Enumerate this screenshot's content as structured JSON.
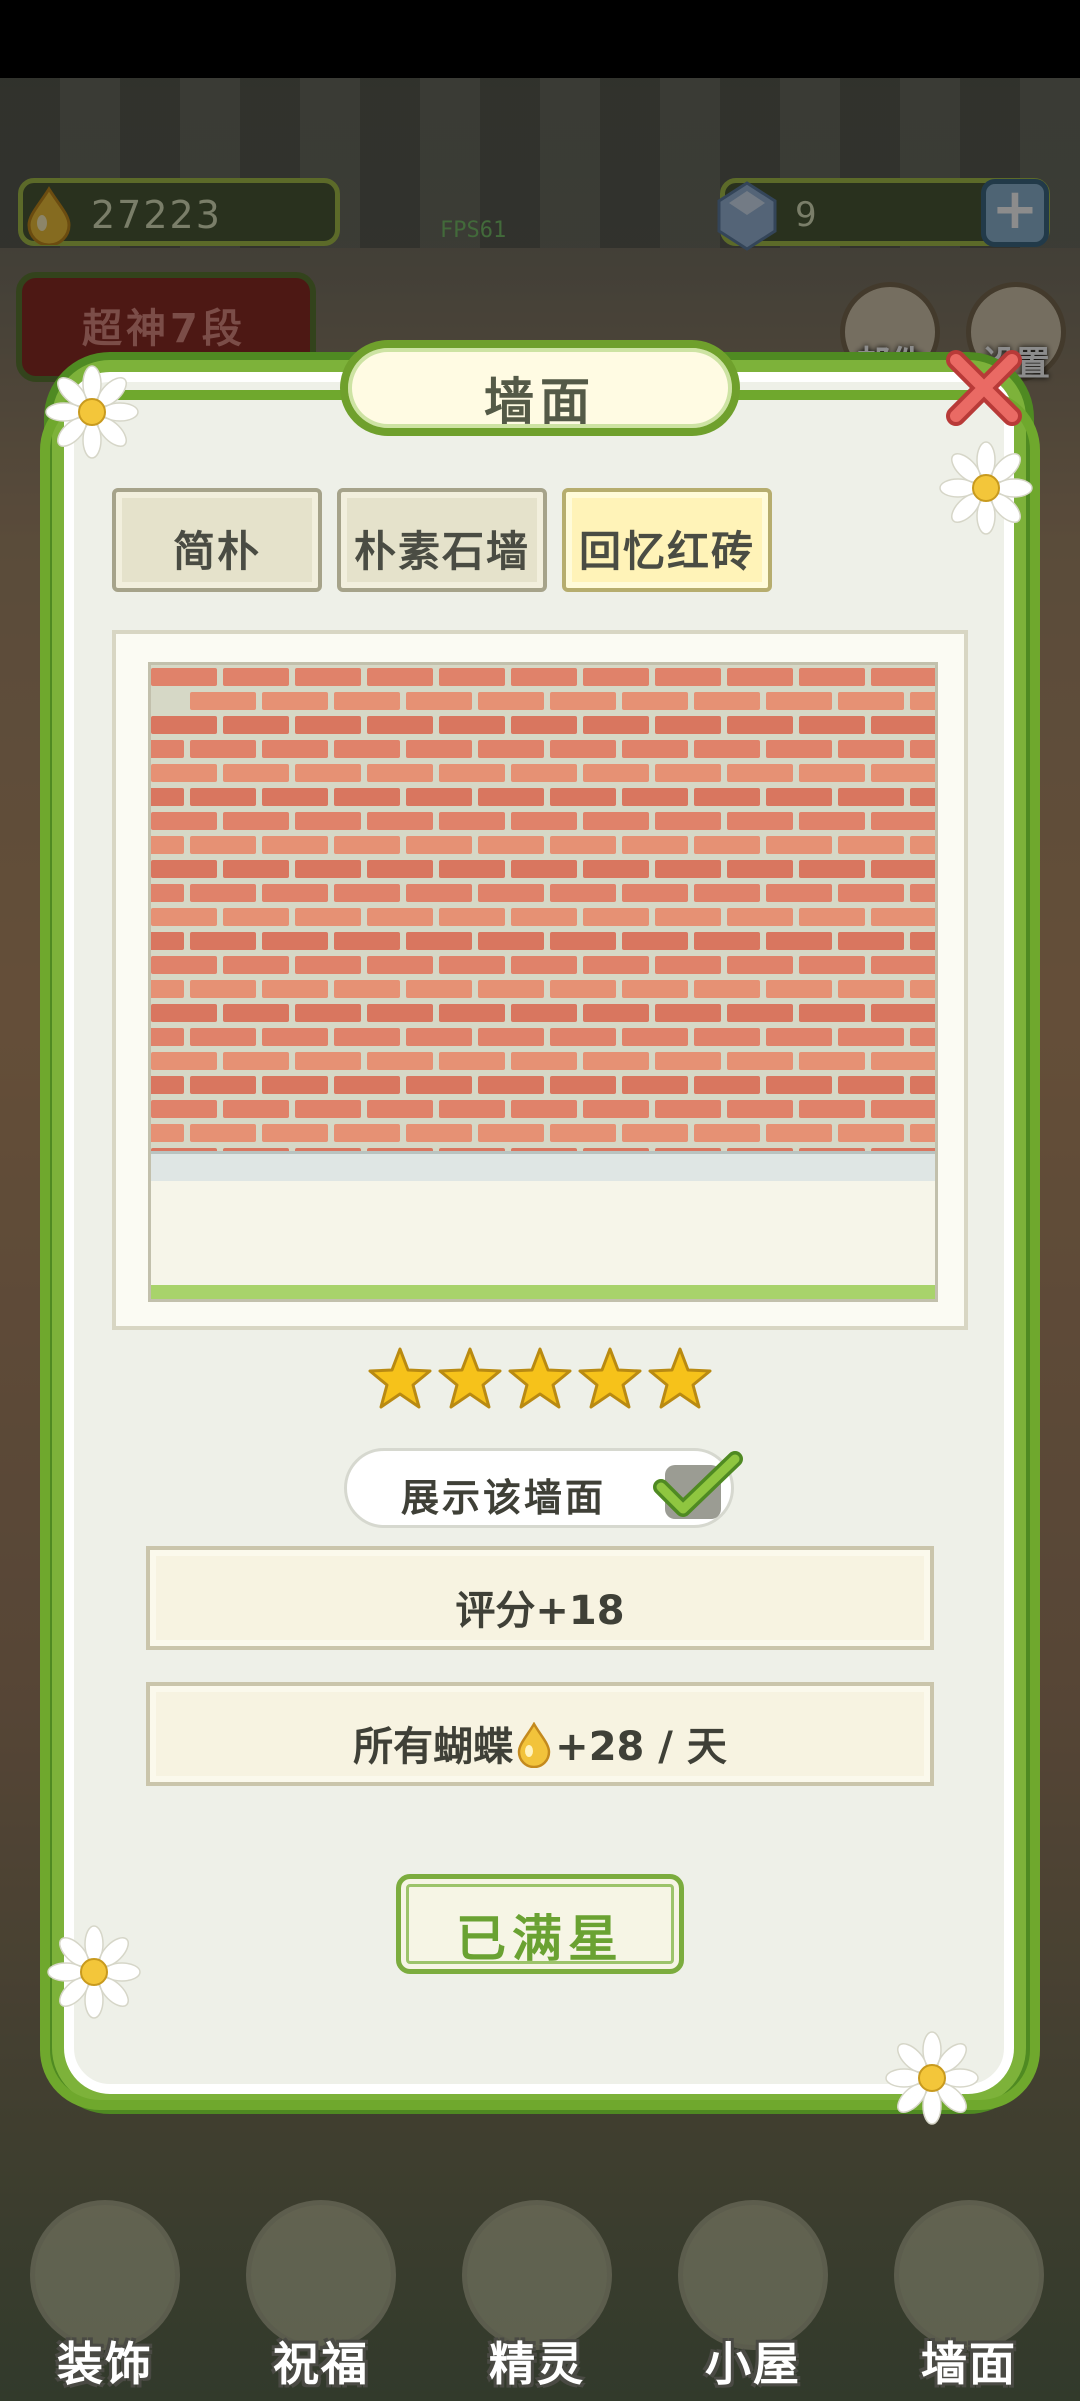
{
  "hud": {
    "coins": "27223",
    "fps": "FPS61",
    "gems": "9",
    "rank": "超神7段",
    "side_buttons": [
      "邮件",
      "设置"
    ]
  },
  "dialog": {
    "title": "墙面",
    "tabs": [
      {
        "label": "简朴",
        "active": false
      },
      {
        "label": "朴素石墙",
        "active": false
      },
      {
        "label": "回忆红砖",
        "active": true
      }
    ],
    "stars_count": 5,
    "show_toggle_label": "展示该墙面",
    "show_toggle_checked": true,
    "score_text": "评分+18",
    "butterfly_prefix": "所有蝴蝶",
    "butterfly_suffix": "+28 / 天",
    "maxed_button": "已满星"
  },
  "bottom_nav": [
    "装饰",
    "祝福",
    "精灵",
    "小屋",
    "墙面"
  ],
  "colors": {
    "accent_green": "#7db23a",
    "star_gold": "#f6c21a",
    "brick": "#e0826a"
  }
}
